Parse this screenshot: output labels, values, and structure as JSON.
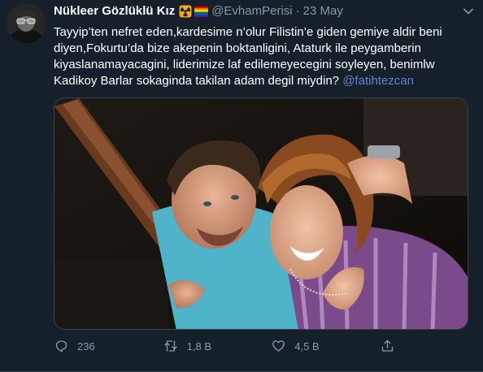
{
  "author": {
    "display_name": "Nükleer Gözlüklü Kız",
    "emoji_icons": [
      "radioactive-icon",
      "rainbow-flag-icon"
    ],
    "handle": "@EvhamPerisi",
    "separator": "·",
    "timestamp": "23 May"
  },
  "tweet": {
    "lines": [
      "Tayyip’ten nefret eden,kardesime n’olur Filistin’e giden gemiye aldir beni",
      "diyen,Fokurtu’da bize  akepenin boktanligini, Ataturk ile peygamberin",
      "kiyaslanamayacagini, liderimize laf edilemeyecegini soyleyen, benimlw",
      "Kadikoy Barlar sokaginda takilan adam degil miydin? "
    ],
    "mention": "@fatihtezcan"
  },
  "actions": {
    "reply_count": "236",
    "retweet_count": "1,8 B",
    "like_count": "4,5 B"
  },
  "colors": {
    "background": "#15202b",
    "muted": "#8899a6",
    "mention": "#6c7fd1",
    "border": "#38444d"
  }
}
